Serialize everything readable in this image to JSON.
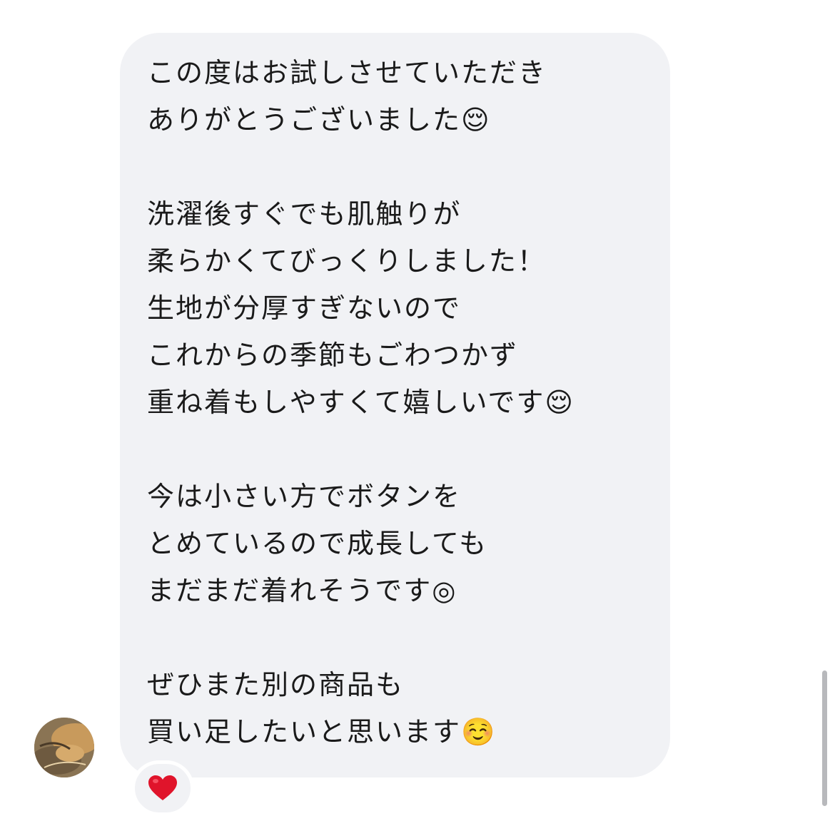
{
  "message": {
    "lines": [
      "この度はお試しさせていただき",
      "ありがとうございました😌",
      "",
      "洗濯後すぐでも肌触りが",
      "柔らかくてびっくりしました！",
      "生地が分厚すぎないので",
      "これからの季節もごわつかず",
      "重ね着もしやすくて嬉しいです😌",
      "",
      "今は小さい方でボタンを",
      "とめているので成長しても",
      "まだまだ着れそうです◎",
      "",
      "ぜひまた別の商品も",
      "買い足したいと思います☺️"
    ]
  },
  "reaction": {
    "emoji": "heart",
    "color": "#e0142b"
  },
  "colors": {
    "bubble": "#f1f2f5",
    "text": "#1a1a1a",
    "scrollbar": "#b8b9bc"
  }
}
